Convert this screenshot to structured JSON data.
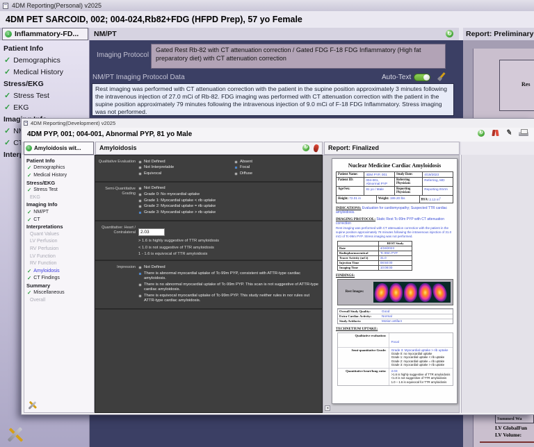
{
  "icons": {
    "app": "app-window-icon",
    "check": "✓",
    "refresh": "↻",
    "arrow_down": "↓",
    "pencil": "✎",
    "scroll_left": "◂"
  },
  "back": {
    "title": "4DM Reporting(Personal) v2025",
    "patient": "4DM PET SARCOID, 002; 004-024,Rb82+FDG (HFPD Prep), 57 yo Female",
    "tab": "Inflammatory-FD...",
    "panel": "NM/PT",
    "report_header": "Report: Preliminary",
    "sidebar": [
      {
        "label": "Patient Info",
        "state": "head"
      },
      {
        "label": "Demographics",
        "state": "done"
      },
      {
        "label": "Medical History",
        "state": "done"
      },
      {
        "label": "Stress/EKG",
        "state": "head"
      },
      {
        "label": "Stress Test",
        "state": "done"
      },
      {
        "label": "EKG",
        "state": "done"
      },
      {
        "label": "Imaging Info",
        "state": "head"
      },
      {
        "label": "NM/PT",
        "state": "done"
      },
      {
        "label": "CT",
        "state": "done"
      },
      {
        "label": "Interpretations",
        "state": "head"
      }
    ],
    "imaging_protocol_label": "Imaging Protocol",
    "imaging_protocol_value": "Gated Rest Rb-82 with CT attenuation correction / Gated FDG F-18 FDG Inflammatory (High fat preparatory diet) with CT attenuation correction",
    "protocol_data_label": "NM/PT Imaging Protocol Data",
    "auto_text_label": "Auto-Text",
    "protocol_text": "Rest imaging was performed with CT attenuation correction with the patient in the supine position approximately 3 minutes following the intravenous injection of 27.0 mCi of Rb-82. FDG imaging was performed with CT attenuation correction with the patient in the supine position approximately 79 minutes following the intravenous injection of 9.0 mCi of F-18 FDG Inflammatory. Stress imaging was not performed.",
    "rest_fragment": "Res",
    "bottom": {
      "summed": "Summed Wa",
      "lv1": "LV GlobalFun",
      "lv2": "LV Volume:"
    }
  },
  "front": {
    "title": "4DM Reporting(Development) v2025",
    "patient": "4DM PYP, 001; 004-001, Abnormal PYP, 81 yo Male",
    "tab": "Amyloidosis wit...",
    "panel": "Amyloidosis",
    "report_header": "Report: Finalized",
    "sidebar": [
      {
        "label": "Patient Info",
        "state": "head"
      },
      {
        "label": "Demographics",
        "state": "done"
      },
      {
        "label": "Medical History",
        "state": "done"
      },
      {
        "label": "Stress/EKG",
        "state": "head"
      },
      {
        "label": "Stress Test",
        "state": "done"
      },
      {
        "label": "EKG",
        "state": "off"
      },
      {
        "label": "Imaging Info",
        "state": "head"
      },
      {
        "label": "NM/PT",
        "state": "done"
      },
      {
        "label": "CT",
        "state": "done"
      },
      {
        "label": "Interpretations",
        "state": "head"
      },
      {
        "label": "Quant Values",
        "state": "off"
      },
      {
        "label": "LV Perfusion",
        "state": "off"
      },
      {
        "label": "RV Perfusion",
        "state": "off"
      },
      {
        "label": "LV Function",
        "state": "off"
      },
      {
        "label": "RV Function",
        "state": "off"
      },
      {
        "label": "Amyloidosis",
        "state": "done sel"
      },
      {
        "label": "CT Findings",
        "state": "done"
      },
      {
        "label": "Summary",
        "state": "head"
      },
      {
        "label": "Miscellaneous",
        "state": "done"
      },
      {
        "label": "Overall",
        "state": "off"
      }
    ],
    "amyloidosis": {
      "qualitative_label": "Qualitative Evaluation",
      "qual_left": [
        {
          "label": "Not Defined",
          "state": "off"
        },
        {
          "label": "Not Interpretable",
          "state": "off"
        },
        {
          "label": "Equivocal",
          "state": "off"
        }
      ],
      "qual_right": [
        {
          "label": "Absent",
          "state": "off"
        },
        {
          "label": "Focal",
          "state": "on"
        },
        {
          "label": "Diffuse",
          "state": "off"
        }
      ],
      "semi_label": "Semi-Quantitative Grading",
      "semi_options": [
        {
          "label": "Not Defined",
          "state": "off"
        },
        {
          "label": "Grade 0: No myocardial uptake",
          "state": "off"
        },
        {
          "label": "Grade 1: Myocardial uptake < rib uptake",
          "state": "off"
        },
        {
          "label": "Grade 2: Myocardial uptake = rib uptake",
          "state": "off"
        },
        {
          "label": "Grade 3: Myocardial uptake > rib uptake",
          "state": "on"
        }
      ],
      "quant_label_1": "Quantitative: Heart /",
      "quant_label_2": "Contralateral",
      "quant_value": "2.03",
      "quant_hints": [
        "> 1.6 is highly suggestive of TTR amyloidosis",
        "< 1.0 is not suggestive of TTR amyloidosis",
        "1 - 1.6 is equivocal of TTR amyloidosis"
      ],
      "impression_label": "Impression",
      "impression_options": [
        {
          "label": "Not Defined",
          "state": "off"
        },
        {
          "label": "There is abnormal myocardial uptake of Tc-99m PYP, consistent with ATTR-type cardiac amyloidosis.",
          "state": "on"
        },
        {
          "label": "There is no abnormal myocardial uptake of Tc-99m PYP. This scan is not suggestive of ATTR-type cardiac amyloidosis.",
          "state": "off"
        },
        {
          "label": "There is equivocal myocardial uptake of Tc-99m PYP. This study neither rules in nor rules out ATTR-type cardiac amyloidosis.",
          "state": "off"
        }
      ]
    },
    "report": {
      "title": "Nuclear Medicine Cardiac Amyloidosis",
      "patient_rows": [
        {
          "l1": "Patient Name:",
          "v1": "4DM PYP, 001",
          "l2": "Study Date:",
          "v2": "4/19/2023"
        },
        {
          "l1": "Patient ID:",
          "v1": "004-001, Abnormal PYP",
          "l2": "Referring Physician:",
          "v2": "Referring, MD"
        },
        {
          "l1": "Age/Sex:",
          "v1": "81 yo / Male",
          "l2": "Reporting Physician:",
          "v2": "Reporting INVIA"
        }
      ],
      "hwb": {
        "h_label": "Height:",
        "h": "72.01 in",
        "w_label": "Weight:",
        "w": "199.20 lbs",
        "b_label": "BSA:",
        "b": "2.13 m",
        "b_sup": "2"
      },
      "indications_label": "INDICATIONS:",
      "indications": "Evaluation for cardiomyopathy; Suspected TTR cardiac amyloidosis.",
      "protocol_label": "IMAGING PROTOCOL:",
      "protocol": "Static Rest Tc-99m PYP with CT attenuation correction",
      "protocol_note": "Rest imaging was performed with CT attenuation correction with the patient in the supine position approximately 78 minutes following the intravenous injection of 31.0 mCi of Tc-99m PYP. Stress imaging was not performed.",
      "rest_header": "REST Study",
      "rest_rows": [
        {
          "label": "Date",
          "value": "4/19/2023"
        },
        {
          "label": "Radiopharmaceutical",
          "value": "Tc-99m PYP"
        },
        {
          "label": "Tracer Activity (mCi)",
          "value": "31.0"
        },
        {
          "label": "Injection Time",
          "value": "08:50:00"
        },
        {
          "label": "Imaging Time",
          "value": "10:08:00"
        }
      ],
      "findings_label": "FINDINGS:",
      "rest_images_label": "Rest Images:",
      "quality_rows": [
        {
          "label": "Overall Study Quality:",
          "value": "Good"
        },
        {
          "label": "Extra Cardiac Activity:",
          "value": "Normal"
        },
        {
          "label": "Study Artifacts:",
          "value": "Motion artifact"
        }
      ],
      "uptake_label": "TECHNETIUM UPTAKE:",
      "uptake_qual_label": "Qualitative evaluation:",
      "uptake_qual": "Focal",
      "uptake_semi_label": "Semi-quantitative Grade:",
      "uptake_semi": "Grade 3: Myocardial uptake > rib uptake",
      "grade_defs": [
        "Grade 0: no myocardial uptake",
        "Grade 1: myocardial uptake < rib uptake",
        "Grade 2: myocardial uptake = rib uptake",
        "Grade 3: myocardial uptake > rib uptake"
      ],
      "ratio_label": "Quantitative heart/lung ratio:",
      "ratio": "2.03",
      "ratio_defs": [
        ">1.6 is highly suggestive of TTR amyloidosis",
        "<1.0 is not suggestive of TTR amyloidosis",
        "1.0 – 1.6 is equivocal for TTR amyloidosis"
      ]
    }
  }
}
